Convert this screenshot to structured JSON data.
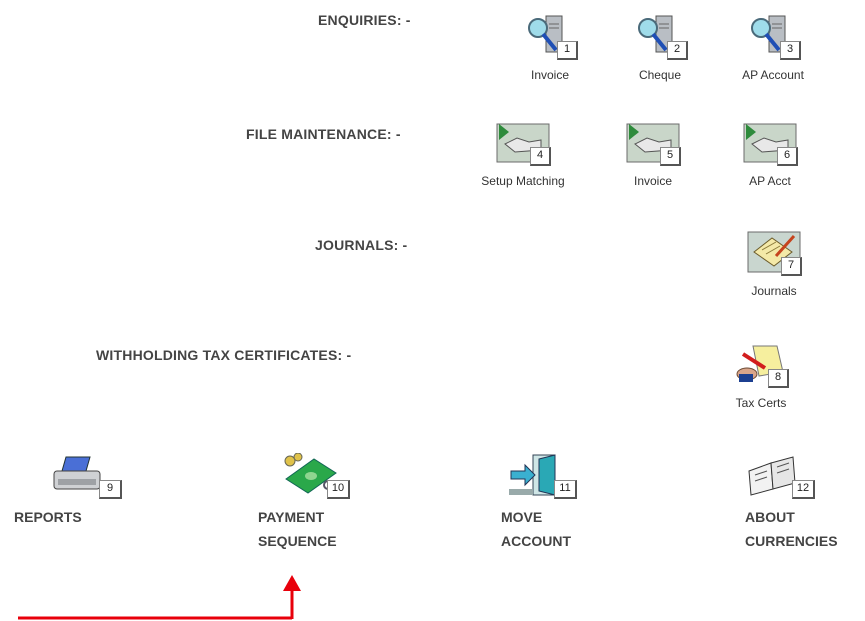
{
  "sections": {
    "enquiries": "ENQUIRIES: -",
    "file_maintenance": "FILE MAINTENANCE: -",
    "journals": "JOURNALS: -",
    "withholding": "WITHHOLDING TAX CERTIFICATES: -"
  },
  "enquiries": [
    {
      "num": "1",
      "label": "Invoice",
      "icon": "magnifier-server-icon"
    },
    {
      "num": "2",
      "label": "Cheque",
      "icon": "magnifier-server-icon"
    },
    {
      "num": "3",
      "label": "AP Account",
      "icon": "magnifier-server-icon"
    }
  ],
  "file_maintenance": [
    {
      "num": "4",
      "label": "Setup Matching",
      "icon": "folder-hand-icon"
    },
    {
      "num": "5",
      "label": "Invoice",
      "icon": "folder-hand-icon"
    },
    {
      "num": "6",
      "label": "AP Acct",
      "icon": "folder-hand-icon"
    }
  ],
  "journals": [
    {
      "num": "7",
      "label": "Journals",
      "icon": "pencil-notepad-icon"
    }
  ],
  "withholding": [
    {
      "num": "8",
      "label": "Tax Certs",
      "icon": "signing-document-icon"
    }
  ],
  "bottom": [
    {
      "num": "9",
      "line1": "REPORTS",
      "line2": "",
      "icon": "printer-icon"
    },
    {
      "num": "10",
      "line1": "PAYMENT",
      "line2": "SEQUENCE",
      "icon": "money-icon"
    },
    {
      "num": "11",
      "line1": "MOVE",
      "line2": "ACCOUNT",
      "icon": "door-arrow-icon"
    },
    {
      "num": "12",
      "line1": "ABOUT",
      "line2": "CURRENCIES",
      "icon": "open-book-icon"
    }
  ],
  "annotation_color": "#e8000b"
}
